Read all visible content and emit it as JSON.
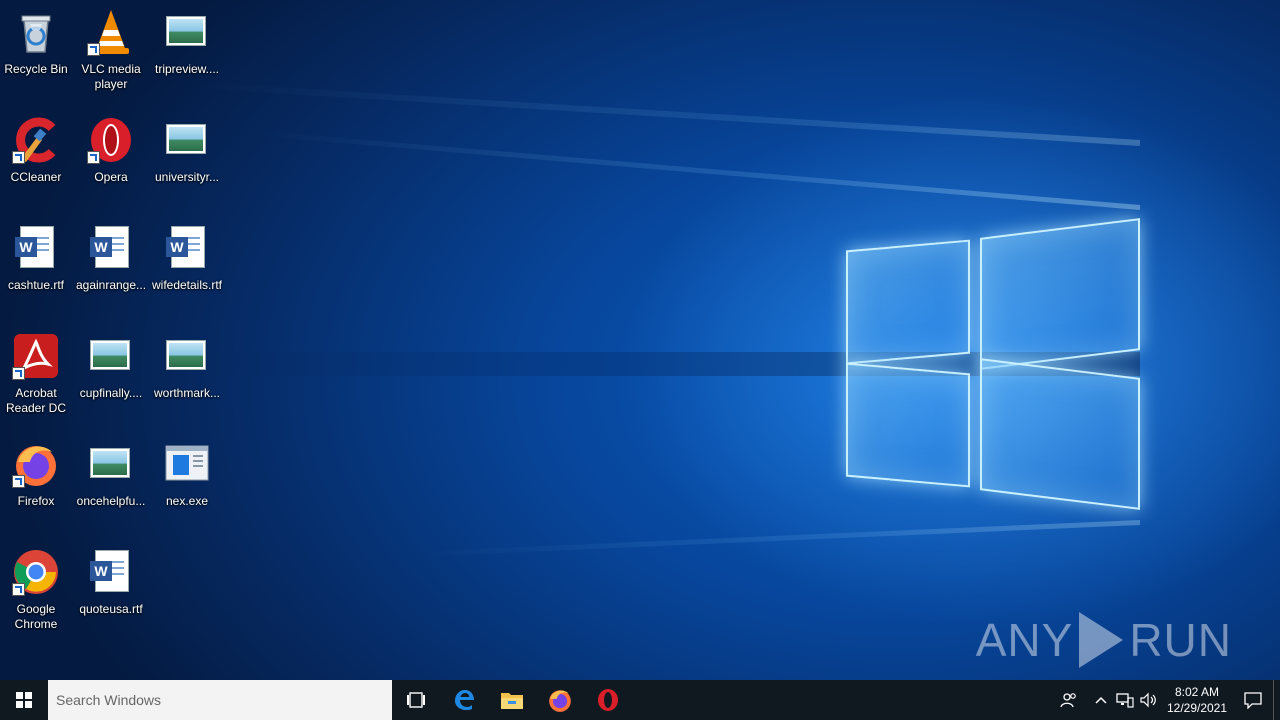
{
  "desktop": {
    "icons": [
      {
        "label": "Recycle Bin",
        "icon": "recycle-bin-icon"
      },
      {
        "label": "VLC media player",
        "icon": "vlc-icon"
      },
      {
        "label": "tripreview....",
        "icon": "image-file-icon"
      },
      {
        "label": "CCleaner",
        "icon": "ccleaner-icon"
      },
      {
        "label": "Opera",
        "icon": "opera-icon"
      },
      {
        "label": "universityr...",
        "icon": "image-file-icon"
      },
      {
        "label": "cashtue.rtf",
        "icon": "word-document-icon"
      },
      {
        "label": "againrange...",
        "icon": "word-document-icon"
      },
      {
        "label": "wifedetails.rtf",
        "icon": "word-document-icon"
      },
      {
        "label": "Acrobat Reader DC",
        "icon": "acrobat-icon"
      },
      {
        "label": "cupfinally....",
        "icon": "image-file-icon"
      },
      {
        "label": "worthmark...",
        "icon": "image-file-icon"
      },
      {
        "label": "Firefox",
        "icon": "firefox-icon"
      },
      {
        "label": "oncehelpfu...",
        "icon": "image-file-icon"
      },
      {
        "label": "nex.exe",
        "icon": "exe-file-icon"
      },
      {
        "label": "Google Chrome",
        "icon": "chrome-icon"
      },
      {
        "label": "quoteusa.rtf",
        "icon": "word-document-icon"
      }
    ]
  },
  "watermark": {
    "left": "ANY",
    "right": "RUN"
  },
  "taskbar": {
    "search_placeholder": "Search Windows",
    "pinned": [
      "task-view-icon",
      "edge-icon",
      "file-explorer-icon",
      "firefox-icon",
      "opera-icon"
    ],
    "clock_time": "8:02 AM",
    "clock_date": "12/29/2021"
  },
  "colors": {
    "taskbar": "#101820",
    "desktop_blue": "#07459a",
    "word_blue": "#2b579a"
  }
}
